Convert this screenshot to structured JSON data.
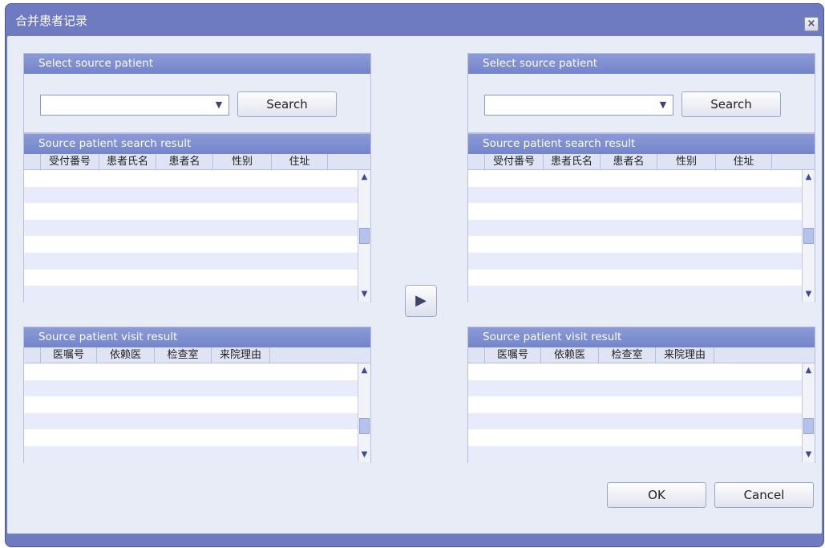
{
  "window": {
    "title": "合并患者记录",
    "close_glyph": "×"
  },
  "left": {
    "select_header": "Select source patient",
    "combo_value": "",
    "combo_arrow": "▼",
    "search_label": "Search",
    "search_result_header": "Source patient search result",
    "search_columns": [
      "受付番号",
      "患者氏名",
      "患者名",
      "性别",
      "住址"
    ],
    "visit_header": "Source patient visit result",
    "visit_columns": [
      "医嘱号",
      "依赖医",
      "检查室",
      "来院理由"
    ]
  },
  "right": {
    "select_header": "Select source patient",
    "combo_value": "",
    "combo_arrow": "▼",
    "search_label": "Search",
    "search_result_header": "Source patient search result",
    "search_columns": [
      "受付番号",
      "患者氏名",
      "患者名",
      "性别",
      "住址"
    ],
    "visit_header": "Source patient visit result",
    "visit_columns": [
      "医嘱号",
      "依赖医",
      "检查室",
      "来院理由"
    ]
  },
  "scroll": {
    "up_glyph": "▲",
    "down_glyph": "▼"
  },
  "move_glyph": "▶",
  "footer": {
    "ok_label": "OK",
    "cancel_label": "Cancel"
  },
  "colors": {
    "title_bar": "#6f7bc0",
    "header": "#7f8fd0",
    "client": "#e8ecf6",
    "row_alt": "#e8ecfa"
  },
  "icons": {
    "close": "close-icon",
    "combo_arrow": "chevron-down-icon",
    "move": "play-arrow-icon"
  }
}
